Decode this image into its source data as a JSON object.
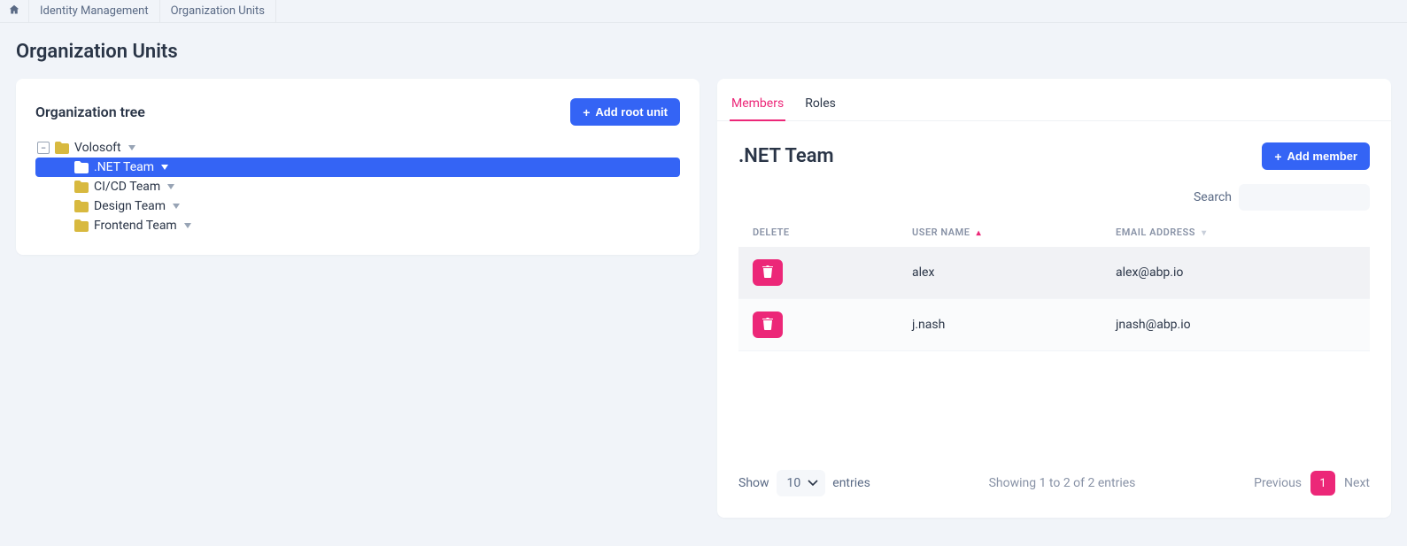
{
  "breadcrumbs": {
    "items": [
      {
        "label": "Identity Management"
      },
      {
        "label": "Organization Units"
      }
    ]
  },
  "page": {
    "title": "Organization Units"
  },
  "treePanel": {
    "title": "Organization tree",
    "addRootLabel": "Add root unit",
    "nodes": {
      "root": {
        "label": "Volosoft"
      },
      "children": [
        {
          "label": ".NET Team",
          "selected": true
        },
        {
          "label": "CI/CD Team"
        },
        {
          "label": "Design Team"
        },
        {
          "label": "Frontend Team"
        }
      ]
    }
  },
  "detail": {
    "tabs": {
      "members": "Members",
      "roles": "Roles"
    },
    "title": ".NET Team",
    "addMemberLabel": "Add member",
    "searchLabel": "Search",
    "columns": {
      "delete": "DELETE",
      "username": "USER NAME",
      "email": "EMAIL ADDRESS"
    },
    "rows": [
      {
        "username": "alex",
        "email": "alex@abp.io"
      },
      {
        "username": "j.nash",
        "email": "jnash@abp.io"
      }
    ],
    "footer": {
      "show": "Show",
      "pageSize": "10",
      "entries": "entries",
      "summary": "Showing 1 to 2 of 2 entries",
      "prev": "Previous",
      "page": "1",
      "next": "Next"
    }
  }
}
